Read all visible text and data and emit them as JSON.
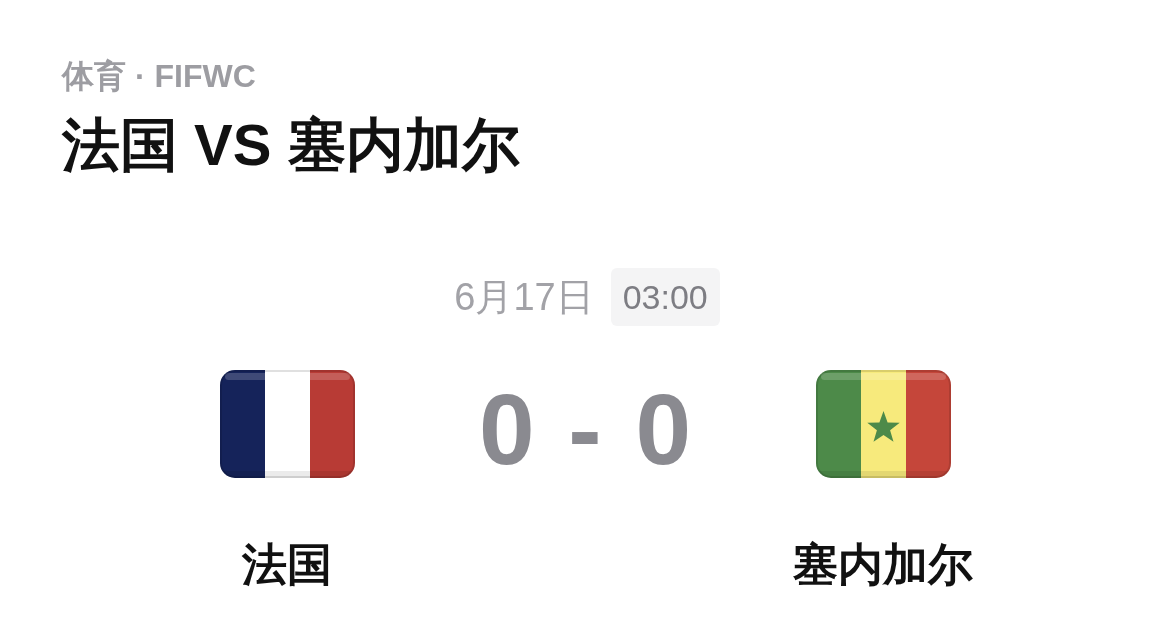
{
  "header": {
    "category": "体育 · FIFWC",
    "title": "法国 VS 塞内加尔"
  },
  "match": {
    "date": "6月17日",
    "time": "03:00",
    "score": "0 - 0",
    "teams": [
      {
        "name": "法国",
        "kind": "tricolor"
      },
      {
        "name": "塞内加尔",
        "kind": "starred"
      }
    ]
  }
}
